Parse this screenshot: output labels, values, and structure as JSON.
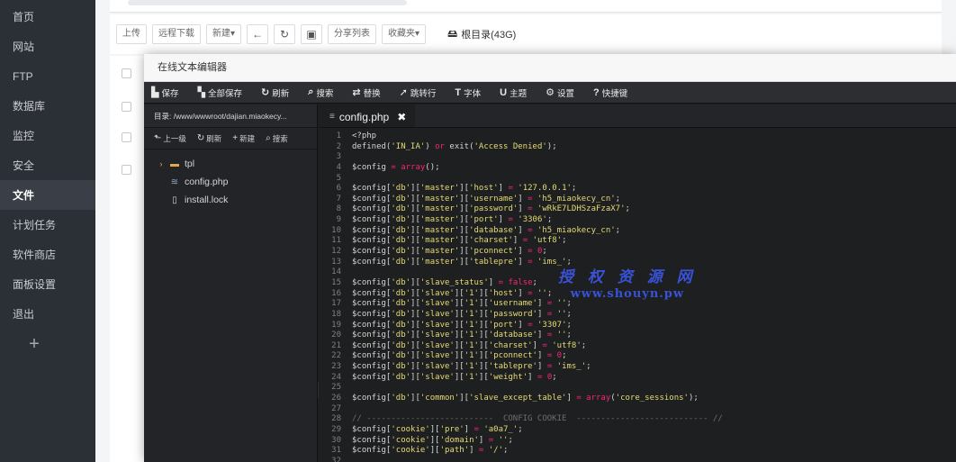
{
  "sidebar": {
    "items": [
      {
        "label": "首页",
        "icon": "home-icon",
        "glyph": "⌂"
      },
      {
        "label": "网站",
        "icon": "globe-icon",
        "glyph": "◉"
      },
      {
        "label": "FTP",
        "icon": "ftp-icon",
        "glyph": "⇅"
      },
      {
        "label": "数据库",
        "icon": "database-icon",
        "glyph": "▤"
      },
      {
        "label": "监控",
        "icon": "monitor-icon",
        "glyph": "◔"
      },
      {
        "label": "安全",
        "icon": "shield-icon",
        "glyph": "⛨"
      },
      {
        "label": "文件",
        "icon": "folder-icon",
        "glyph": "▰",
        "active": true
      },
      {
        "label": "计划任务",
        "icon": "clock-icon",
        "glyph": "◷"
      },
      {
        "label": "软件商店",
        "icon": "store-icon",
        "glyph": "▦"
      },
      {
        "label": "面板设置",
        "icon": "settings-icon",
        "glyph": "⚙"
      },
      {
        "label": "退出",
        "icon": "logout-icon",
        "glyph": "⏻"
      }
    ],
    "add_label": "+"
  },
  "file_manager": {
    "toolbar": {
      "upload": "上传",
      "remote_download": "远程下载",
      "new": "新建▾",
      "back_icon": "←",
      "refresh_icon": "↻",
      "terminal_icon": "▣",
      "share_list": "分享列表",
      "favorites": "收藏夹▾",
      "root_label": "根目录(43G)",
      "root_icon": "🖴"
    }
  },
  "dialog": {
    "title": "在线文本编辑器",
    "toolbar": [
      {
        "label": "保存",
        "glyph": "▙",
        "icon": "save-icon"
      },
      {
        "label": "全部保存",
        "glyph": "▚",
        "icon": "save-all-icon"
      },
      {
        "label": "刷新",
        "glyph": "↻",
        "icon": "refresh-icon"
      },
      {
        "label": "搜索",
        "glyph": "⌕",
        "icon": "search-icon"
      },
      {
        "label": "替换",
        "glyph": "⇄",
        "icon": "replace-icon"
      },
      {
        "label": "跳转行",
        "glyph": "➚",
        "icon": "goto-line-icon"
      },
      {
        "label": "字体",
        "glyph": "T",
        "icon": "font-icon"
      },
      {
        "label": "主题",
        "glyph": "U",
        "icon": "theme-icon"
      },
      {
        "label": "设置",
        "glyph": "⚙",
        "icon": "settings-icon"
      },
      {
        "label": "快捷键",
        "glyph": "?",
        "icon": "shortcut-icon"
      }
    ],
    "tree": {
      "path": "目录: /www/wwwroot/dajian.miaokecy...",
      "actions": [
        {
          "label": "上一级",
          "glyph": "⬑",
          "icon": "up-level-icon"
        },
        {
          "label": "刷新",
          "glyph": "↻",
          "icon": "refresh-icon"
        },
        {
          "label": "新建",
          "glyph": "+",
          "icon": "new-icon"
        },
        {
          "label": "搜索",
          "glyph": "⌕",
          "icon": "search-icon"
        }
      ],
      "items": [
        {
          "label": "tpl",
          "type": "folder"
        },
        {
          "label": "config.php",
          "type": "php"
        },
        {
          "label": "install.lock",
          "type": "file"
        }
      ]
    },
    "tab": {
      "label": "config.php",
      "close": "✖"
    },
    "code_lines": [
      "<?php",
      "defined('IN_IA') or exit('Access Denied');",
      "",
      "$config = array();",
      "",
      "$config['db']['master']['host'] = '127.0.0.1';",
      "$config['db']['master']['username'] = 'h5_miaokecy_cn';",
      "$config['db']['master']['password'] = 'wRkE7LDHSzaFzaX7';",
      "$config['db']['master']['port'] = '3306';",
      "$config['db']['master']['database'] = 'h5_miaokecy_cn';",
      "$config['db']['master']['charset'] = 'utf8';",
      "$config['db']['master']['pconnect'] = 0;",
      "$config['db']['master']['tablepre'] = 'ims_';",
      "",
      "$config['db']['slave_status'] = false;",
      "$config['db']['slave']['1']['host'] = '';",
      "$config['db']['slave']['1']['username'] = '';",
      "$config['db']['slave']['1']['password'] = '';",
      "$config['db']['slave']['1']['port'] = '3307';",
      "$config['db']['slave']['1']['database'] = '';",
      "$config['db']['slave']['1']['charset'] = 'utf8';",
      "$config['db']['slave']['1']['pconnect'] = 0;",
      "$config['db']['slave']['1']['tablepre'] = 'ims_';",
      "$config['db']['slave']['1']['weight'] = 0;",
      "",
      "$config['db']['common']['slave_except_table'] = array('core_sessions');",
      "",
      "// --------------------------  CONFIG COOKIE  --------------------------- //",
      "$config['cookie']['pre'] = 'a0a7_';",
      "$config['cookie']['domain'] = '';",
      "$config['cookie']['path'] = '/';",
      ""
    ]
  },
  "watermark": {
    "line1": "授 权 资 源 网",
    "line2": "www.shouyn.pw"
  }
}
